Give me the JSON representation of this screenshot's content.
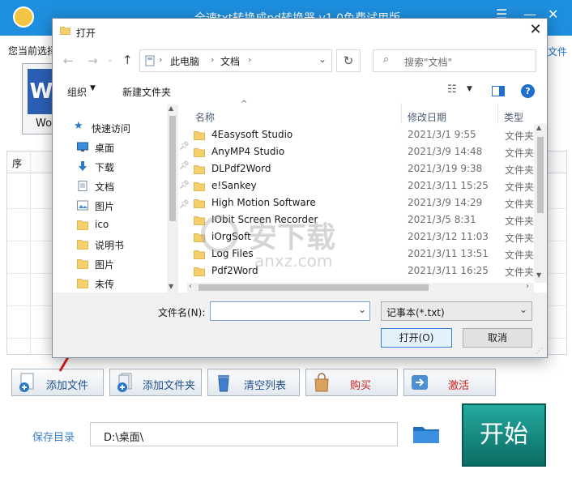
{
  "app": {
    "title": "全速txt转换成pd转换器 v1.0免费试用版",
    "status_text": "您当前选择",
    "right_link": "文件",
    "tile_label": "Wo",
    "table": {
      "col_index": "序"
    },
    "buttons": {
      "add_file": "添加文件",
      "add_folder": "添加文件夹",
      "clear_list": "清空列表",
      "buy": "购买",
      "activate": "激活"
    },
    "save_dir_label": "保存目录",
    "save_dir_value": "D:\\桌面\\",
    "start_label": "开始",
    "colors": {
      "titlebar": "#1e8ede",
      "start": "#138a7f",
      "arrow": "#d0201c"
    }
  },
  "dialog": {
    "title": "打开",
    "breadcrumb": [
      "此电脑",
      "文档"
    ],
    "search_placeholder": "搜索\"文档\"",
    "organize_label": "组织",
    "new_folder_label": "新建文件夹",
    "nav": [
      {
        "label": "快速访问",
        "icon": "star-icon",
        "pinned": false
      },
      {
        "label": "桌面",
        "icon": "desktop-icon",
        "pinned": true
      },
      {
        "label": "下载",
        "icon": "download-icon",
        "pinned": true
      },
      {
        "label": "文档",
        "icon": "document-icon",
        "pinned": true
      },
      {
        "label": "图片",
        "icon": "pictures-icon",
        "pinned": true
      },
      {
        "label": "ico",
        "icon": "folder-icon",
        "pinned": false
      },
      {
        "label": "说明书",
        "icon": "folder-icon",
        "pinned": false
      },
      {
        "label": "图片",
        "icon": "folder-icon",
        "pinned": false
      },
      {
        "label": "未传",
        "icon": "folder-icon",
        "pinned": false
      }
    ],
    "columns": {
      "name": "名称",
      "date": "修改日期",
      "type": "类型"
    },
    "files": [
      {
        "name": "4Easysoft Studio",
        "date": "2021/3/1 9:55",
        "type": "文件夹"
      },
      {
        "name": "AnyMP4 Studio",
        "date": "2021/3/9 14:48",
        "type": "文件夹"
      },
      {
        "name": "DLPdf2Word",
        "date": "2021/3/19 9:38",
        "type": "文件夹"
      },
      {
        "name": "e!Sankey",
        "date": "2021/3/11 15:25",
        "type": "文件夹"
      },
      {
        "name": "High Motion Software",
        "date": "2021/3/9 14:29",
        "type": "文件夹"
      },
      {
        "name": "IObit Screen Recorder",
        "date": "2021/3/5 8:31",
        "type": "文件夹"
      },
      {
        "name": "iOrgSoft",
        "date": "2021/3/12 11:03",
        "type": "文件夹"
      },
      {
        "name": "Log Files",
        "date": "2021/3/11 13:51",
        "type": "文件夹"
      },
      {
        "name": "Pdf2Word",
        "date": "2021/3/11 16:25",
        "type": "文件夹"
      }
    ],
    "filename_label": "文件名(N):",
    "filename_value": "",
    "filetype_value": "记事本(*.txt)",
    "open_label": "打开(O)",
    "cancel_label": "取消"
  },
  "watermark": {
    "text": "安下载",
    "subtext": "anxz.com"
  }
}
